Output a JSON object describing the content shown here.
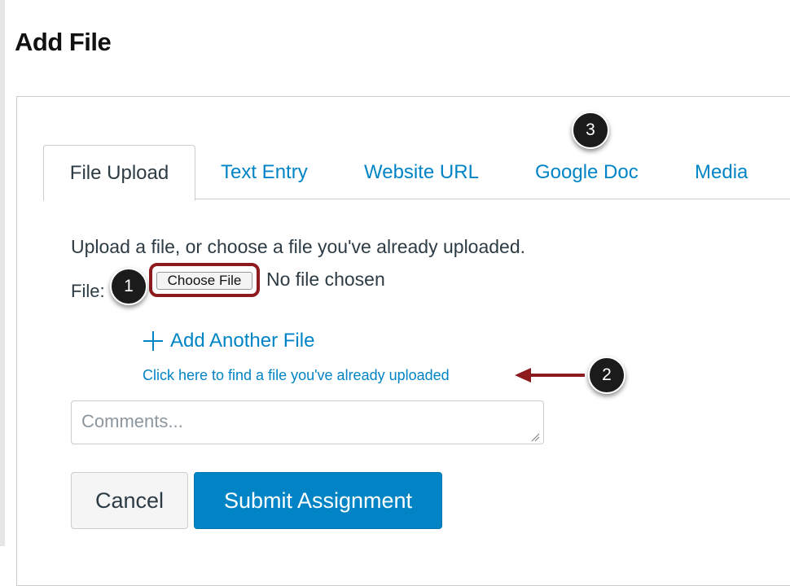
{
  "page": {
    "title": "Add File"
  },
  "tabs": [
    {
      "label": "File Upload",
      "active": true
    },
    {
      "label": "Text Entry",
      "active": false
    },
    {
      "label": "Website URL",
      "active": false
    },
    {
      "label": "Google Doc",
      "active": false
    },
    {
      "label": "Media",
      "active": false
    }
  ],
  "upload": {
    "instructions": "Upload a file, or choose a file you've already uploaded.",
    "file_label": "File:",
    "choose_button": "Choose File",
    "no_file_text": "No file chosen",
    "add_another": "Add Another File",
    "find_uploaded_link": "Click here to find a file you've already uploaded",
    "comments_placeholder": "Comments..."
  },
  "buttons": {
    "cancel": "Cancel",
    "submit": "Submit Assignment"
  },
  "callouts": {
    "one": "1",
    "two": "2",
    "three": "3"
  },
  "icons": {
    "add": "plus-icon",
    "arrow": "arrow-left-icon",
    "grip": "resize-grip-icon"
  },
  "colors": {
    "link": "#0084c6",
    "primary": "#0084c6",
    "highlight": "#8d1b1e",
    "callout": "#1b1b1b"
  }
}
